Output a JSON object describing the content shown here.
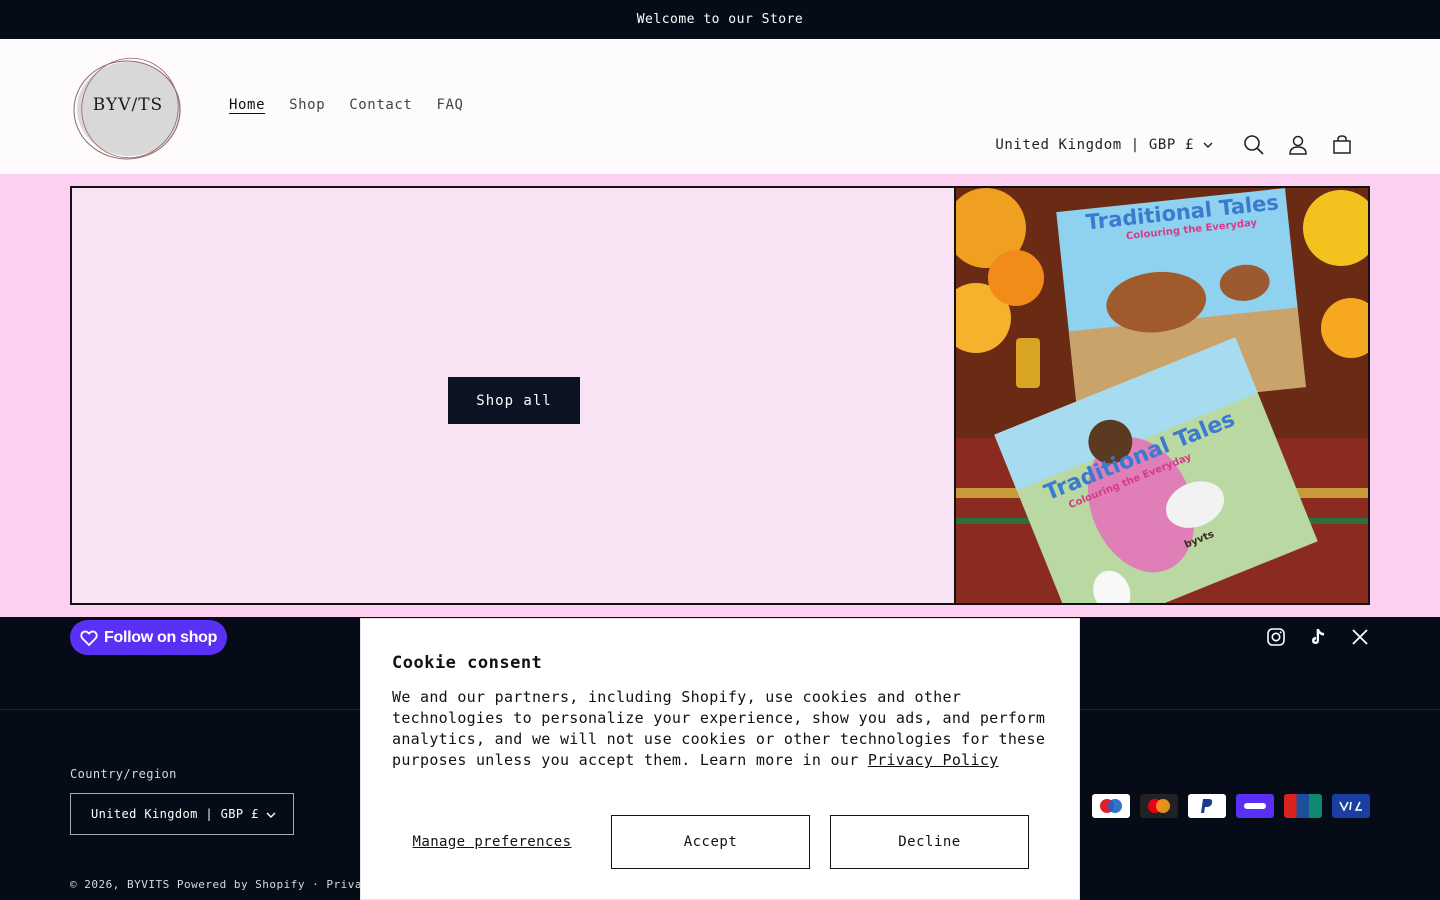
{
  "announcement": "Welcome to our Store",
  "logo": {
    "text": "BYV/TS"
  },
  "nav": {
    "items": [
      {
        "label": "Home",
        "active": true
      },
      {
        "label": "Shop",
        "active": false
      },
      {
        "label": "Contact",
        "active": false
      },
      {
        "label": "FAQ",
        "active": false
      }
    ]
  },
  "header": {
    "locale": "United Kingdom | GBP £",
    "icons": [
      "search-icon",
      "account-icon",
      "cart-icon"
    ]
  },
  "hero": {
    "button": "Shop all",
    "image_text": {
      "title": "Traditional Tales",
      "subtitle": "Colouring the Everyday",
      "brand": "byvts"
    }
  },
  "footer": {
    "follow": "Follow on shop",
    "socials": [
      "instagram-icon",
      "tiktok-icon",
      "x-icon"
    ],
    "country_label": "Country/region",
    "country_value": "United Kingdom | GBP £",
    "payments": [
      "Maestro",
      "Mastercard",
      "PayPal",
      "Shop Pay",
      "UnionPay",
      "Visa"
    ],
    "copyright": "© 2026, BYVITS  Powered by Shopify  ·  Privacy"
  },
  "cookie": {
    "title": "Cookie consent",
    "body": "We and our partners, including Shopify, use cookies and other technologies to personalize your experience, show you ads, and perform analytics, and we will not use cookies or other technologies for these purposes unless you accept them. Learn more in our ",
    "link": "Privacy Policy",
    "manage": "Manage preferences",
    "accept": "Accept",
    "decline": "Decline"
  },
  "colors": {
    "announcement_bg": "#050c17",
    "hero_band": "#fdcff0",
    "hero_panel": "#f7e3f3",
    "button_bg": "#0b1323",
    "shop_purple": "#5a31f4"
  }
}
